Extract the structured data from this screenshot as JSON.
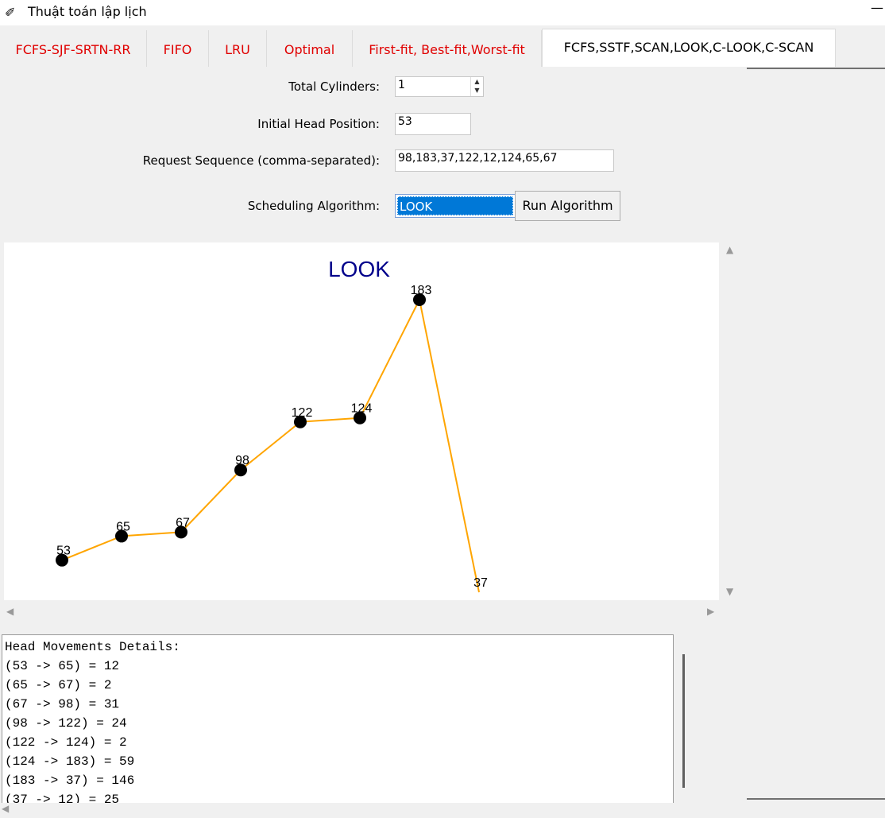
{
  "window": {
    "title": "Thuật toán lập lịch",
    "app_icon": "feather-icon",
    "minimize_glyph": "—"
  },
  "tabs": [
    {
      "label": "FCFS-SJF-SRTN-RR",
      "active": false
    },
    {
      "label": "FIFO",
      "active": false
    },
    {
      "label": "LRU",
      "active": false
    },
    {
      "label": "Optimal",
      "active": false
    },
    {
      "label": "First-fit, Best-fit,Worst-fit",
      "active": false
    },
    {
      "label": "FCFS,SSTF,SCAN,LOOK,C-LOOK,C-SCAN",
      "active": true
    }
  ],
  "form": {
    "total_cylinders_label": "Total Cylinders:",
    "total_cylinders_value": "1",
    "initial_head_label": "Initial Head Position:",
    "initial_head_value": "53",
    "request_sequence_label": "Request Sequence (comma-separated):",
    "request_sequence_value": "98,183,37,122,12,124,65,67",
    "algorithm_label": "Scheduling Algorithm:",
    "algorithm_value": "LOOK",
    "run_button_label": "Run Algorithm"
  },
  "chart_data": {
    "type": "line",
    "title": "LOOK",
    "line_color": "#ffa500",
    "marker_color": "#000000",
    "title_color": "#00008b",
    "x": [
      0,
      1,
      2,
      3,
      4,
      5,
      6,
      7
    ],
    "values": [
      53,
      65,
      67,
      98,
      122,
      124,
      183,
      37
    ],
    "point_labels": [
      "53",
      "65",
      "67",
      "98",
      "122",
      "124",
      "183",
      "37"
    ]
  },
  "details": {
    "lines": [
      "Head Movements Details:",
      "(53 -> 65) = 12",
      "(65 -> 67) = 2",
      "(67 -> 98) = 31",
      "(98 -> 122) = 24",
      "(122 -> 124) = 2",
      "(124 -> 183) = 59",
      "(183 -> 37) = 146",
      "(37 -> 12) = 25"
    ]
  }
}
